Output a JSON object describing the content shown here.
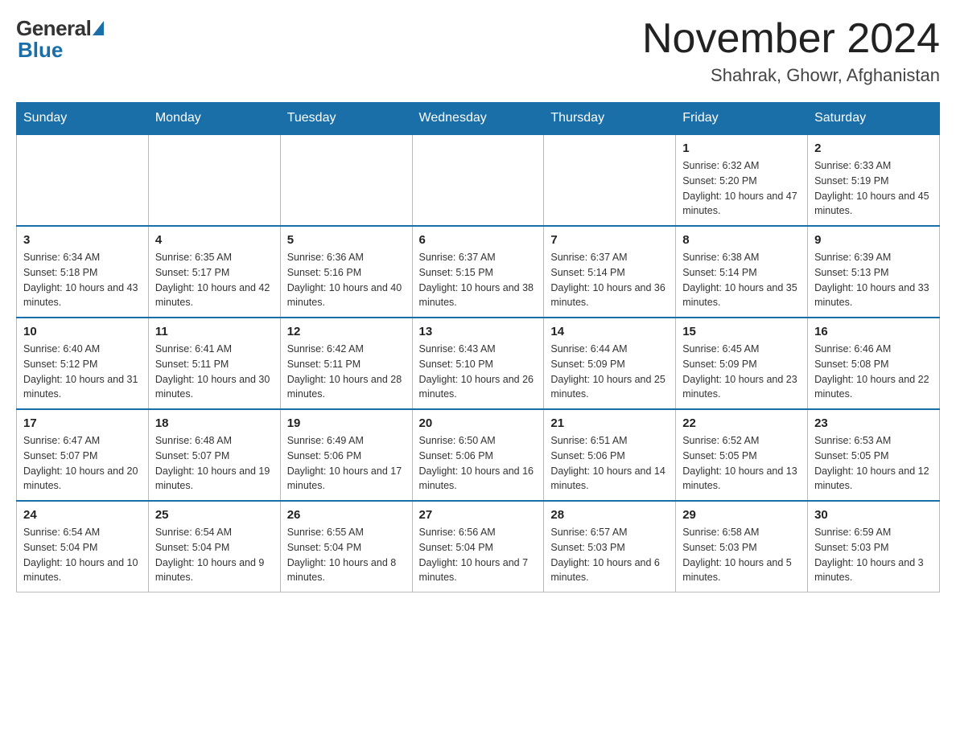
{
  "logo": {
    "general": "General",
    "blue": "Blue"
  },
  "header": {
    "month_year": "November 2024",
    "location": "Shahrak, Ghowr, Afghanistan"
  },
  "weekdays": [
    "Sunday",
    "Monday",
    "Tuesday",
    "Wednesday",
    "Thursday",
    "Friday",
    "Saturday"
  ],
  "weeks": [
    [
      {
        "day": "",
        "info": ""
      },
      {
        "day": "",
        "info": ""
      },
      {
        "day": "",
        "info": ""
      },
      {
        "day": "",
        "info": ""
      },
      {
        "day": "",
        "info": ""
      },
      {
        "day": "1",
        "info": "Sunrise: 6:32 AM\nSunset: 5:20 PM\nDaylight: 10 hours and 47 minutes."
      },
      {
        "day": "2",
        "info": "Sunrise: 6:33 AM\nSunset: 5:19 PM\nDaylight: 10 hours and 45 minutes."
      }
    ],
    [
      {
        "day": "3",
        "info": "Sunrise: 6:34 AM\nSunset: 5:18 PM\nDaylight: 10 hours and 43 minutes."
      },
      {
        "day": "4",
        "info": "Sunrise: 6:35 AM\nSunset: 5:17 PM\nDaylight: 10 hours and 42 minutes."
      },
      {
        "day": "5",
        "info": "Sunrise: 6:36 AM\nSunset: 5:16 PM\nDaylight: 10 hours and 40 minutes."
      },
      {
        "day": "6",
        "info": "Sunrise: 6:37 AM\nSunset: 5:15 PM\nDaylight: 10 hours and 38 minutes."
      },
      {
        "day": "7",
        "info": "Sunrise: 6:37 AM\nSunset: 5:14 PM\nDaylight: 10 hours and 36 minutes."
      },
      {
        "day": "8",
        "info": "Sunrise: 6:38 AM\nSunset: 5:14 PM\nDaylight: 10 hours and 35 minutes."
      },
      {
        "day": "9",
        "info": "Sunrise: 6:39 AM\nSunset: 5:13 PM\nDaylight: 10 hours and 33 minutes."
      }
    ],
    [
      {
        "day": "10",
        "info": "Sunrise: 6:40 AM\nSunset: 5:12 PM\nDaylight: 10 hours and 31 minutes."
      },
      {
        "day": "11",
        "info": "Sunrise: 6:41 AM\nSunset: 5:11 PM\nDaylight: 10 hours and 30 minutes."
      },
      {
        "day": "12",
        "info": "Sunrise: 6:42 AM\nSunset: 5:11 PM\nDaylight: 10 hours and 28 minutes."
      },
      {
        "day": "13",
        "info": "Sunrise: 6:43 AM\nSunset: 5:10 PM\nDaylight: 10 hours and 26 minutes."
      },
      {
        "day": "14",
        "info": "Sunrise: 6:44 AM\nSunset: 5:09 PM\nDaylight: 10 hours and 25 minutes."
      },
      {
        "day": "15",
        "info": "Sunrise: 6:45 AM\nSunset: 5:09 PM\nDaylight: 10 hours and 23 minutes."
      },
      {
        "day": "16",
        "info": "Sunrise: 6:46 AM\nSunset: 5:08 PM\nDaylight: 10 hours and 22 minutes."
      }
    ],
    [
      {
        "day": "17",
        "info": "Sunrise: 6:47 AM\nSunset: 5:07 PM\nDaylight: 10 hours and 20 minutes."
      },
      {
        "day": "18",
        "info": "Sunrise: 6:48 AM\nSunset: 5:07 PM\nDaylight: 10 hours and 19 minutes."
      },
      {
        "day": "19",
        "info": "Sunrise: 6:49 AM\nSunset: 5:06 PM\nDaylight: 10 hours and 17 minutes."
      },
      {
        "day": "20",
        "info": "Sunrise: 6:50 AM\nSunset: 5:06 PM\nDaylight: 10 hours and 16 minutes."
      },
      {
        "day": "21",
        "info": "Sunrise: 6:51 AM\nSunset: 5:06 PM\nDaylight: 10 hours and 14 minutes."
      },
      {
        "day": "22",
        "info": "Sunrise: 6:52 AM\nSunset: 5:05 PM\nDaylight: 10 hours and 13 minutes."
      },
      {
        "day": "23",
        "info": "Sunrise: 6:53 AM\nSunset: 5:05 PM\nDaylight: 10 hours and 12 minutes."
      }
    ],
    [
      {
        "day": "24",
        "info": "Sunrise: 6:54 AM\nSunset: 5:04 PM\nDaylight: 10 hours and 10 minutes."
      },
      {
        "day": "25",
        "info": "Sunrise: 6:54 AM\nSunset: 5:04 PM\nDaylight: 10 hours and 9 minutes."
      },
      {
        "day": "26",
        "info": "Sunrise: 6:55 AM\nSunset: 5:04 PM\nDaylight: 10 hours and 8 minutes."
      },
      {
        "day": "27",
        "info": "Sunrise: 6:56 AM\nSunset: 5:04 PM\nDaylight: 10 hours and 7 minutes."
      },
      {
        "day": "28",
        "info": "Sunrise: 6:57 AM\nSunset: 5:03 PM\nDaylight: 10 hours and 6 minutes."
      },
      {
        "day": "29",
        "info": "Sunrise: 6:58 AM\nSunset: 5:03 PM\nDaylight: 10 hours and 5 minutes."
      },
      {
        "day": "30",
        "info": "Sunrise: 6:59 AM\nSunset: 5:03 PM\nDaylight: 10 hours and 3 minutes."
      }
    ]
  ]
}
